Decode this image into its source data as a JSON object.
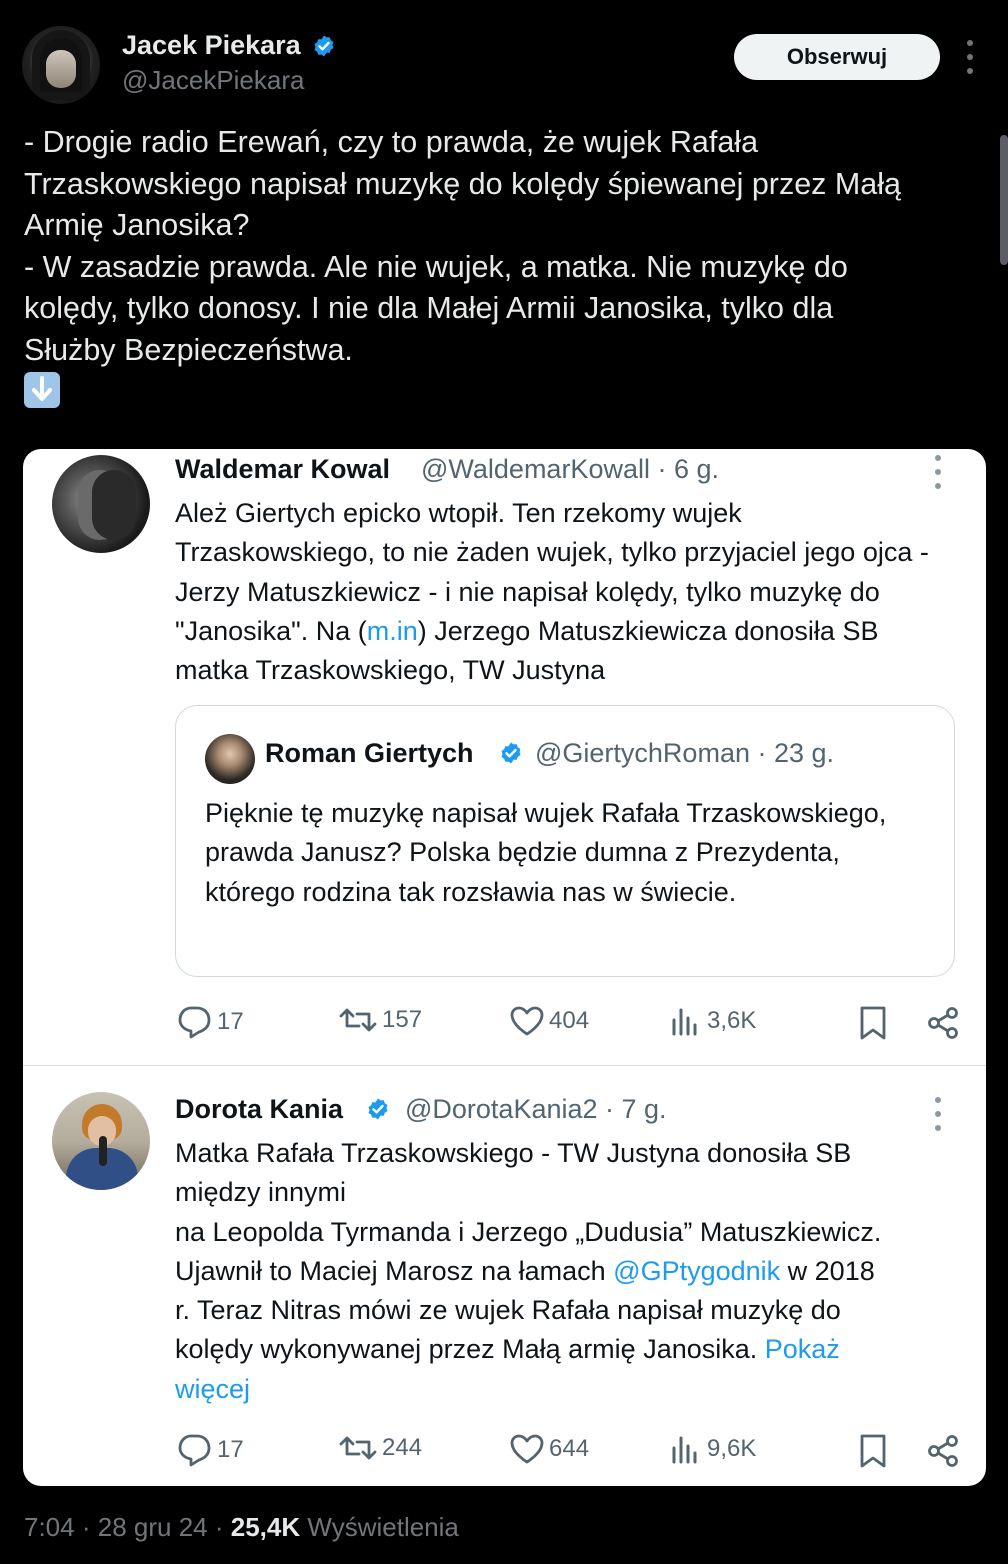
{
  "tweet": {
    "author_name": "Jacek Piekara",
    "author_handle": "@JacekPiekara",
    "follow_label": "Obserwuj",
    "text_lines": [
      "- Drogie radio Erewań, czy to prawda, że wujek Rafała",
      "Trzaskowskiego napisał muzykę do kolędy śpiewanej przez Małą",
      "Armię Janosika?",
      "- W zasadzie prawda. Ale nie wujek, a matka. Nie muzykę do",
      "kolędy, tylko donosy. I nie dla Małej Armii Janosika, tylko dla",
      "Służby Bezpieczeństwa."
    ],
    "arrow_emoji": "down-arrow-emoji",
    "time": "7:04",
    "sep1": "·",
    "date": "28 gru 24",
    "sep2": "·",
    "views": "25,4K",
    "views_label": "Wyświetlenia"
  },
  "card1": {
    "name": "Waldemar Kowal",
    "handle_meta": "@WaldemarKowall · 6 g.",
    "text_a": "Ależ Giertych epicko wtopił. Ten rzekomy wujek Trzaskowskiego, to nie żaden wujek, tylko przyjaciel jego ojca - Jerzy Matuszkiewicz - i nie napisał kolędy, tylko muzykę do \"Janosika\". Na (",
    "text_link": "m.in",
    "text_b": ") Jerzego Matuszkiewicza donosiła SB matka Trzaskowskiego, TW Justyna",
    "quote": {
      "name": "Roman Giertych",
      "handle_meta": "@GiertychRoman · 23 g.",
      "text": "Pięknie tę muzykę napisał wujek Rafała Trzaskowskiego, prawda Janusz? Polska będzie dumna z Prezydenta, którego rodzina tak rozsławia nas w świecie."
    },
    "replies": "17",
    "retweets": "157",
    "likes": "404",
    "views": "3,6K"
  },
  "card2": {
    "name": "Dorota Kania",
    "handle_meta": "@DorotaKania2 · 7 g.",
    "line1": "Matka Rafała Trzaskowskiego - TW Justyna donosiła SB",
    "line2": "między innymi",
    "line3": "na Leopolda Tyrmanda i Jerzego „Dudusia” Matuszkiewicz.",
    "line4_a": "Ujawnił to Maciej Marosz na łamach ",
    "line4_link": "@GPtygodnik",
    "line4_b": " w 2018",
    "line5": "r. Teraz Nitras mówi ze wujek Rafała napisał muzykę do",
    "line6_a": "kolędy wykonywanej przez Małą armię Janosika. ",
    "show_more_1": "Pokaż",
    "show_more_2": "więcej",
    "replies": "17",
    "retweets": "244",
    "likes": "644",
    "views": "9,6K"
  },
  "colors": {
    "background": "#000000",
    "text_primary": "#e7e9ea",
    "text_secondary": "#71767b",
    "link": "#1d9bf0",
    "verified": "#1d9bf0"
  }
}
